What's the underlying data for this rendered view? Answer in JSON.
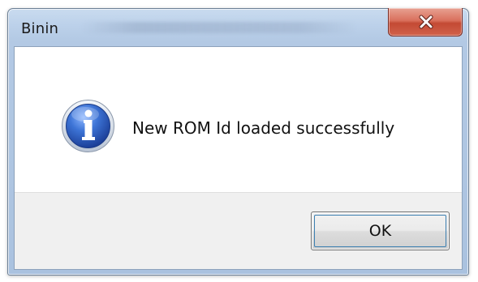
{
  "window": {
    "title": "Binin"
  },
  "titlebar": {
    "close_icon": "close-icon",
    "close_color": "#c94a33"
  },
  "dialog": {
    "icon": "info-icon",
    "icon_color": "#2f5fb5",
    "message": "New ROM Id loaded successfully"
  },
  "buttons": {
    "ok_label": "OK"
  }
}
